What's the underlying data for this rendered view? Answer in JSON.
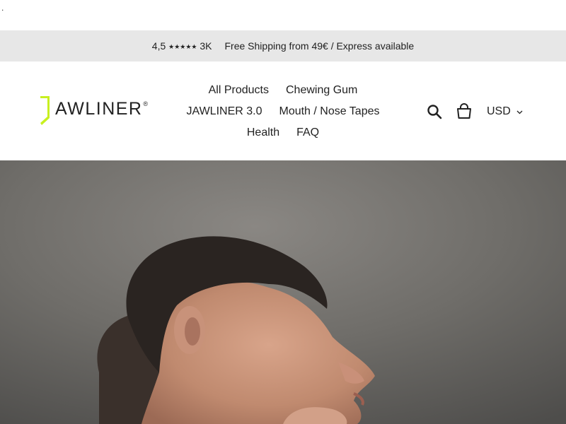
{
  "top_marker": ".",
  "announcement": {
    "rating": "4,5",
    "stars": "★★★★★",
    "reviews": "3K",
    "shipping": "Free Shipping from 49€ / Express available"
  },
  "logo": {
    "text": "AWLINER",
    "reg": "®",
    "accent_color": "#c8f020"
  },
  "nav": {
    "rows": [
      [
        "All Products",
        "Chewing Gum"
      ],
      [
        "JAWLINER 3.0",
        "Mouth / Nose Tapes"
      ],
      [
        "Health",
        "FAQ"
      ]
    ]
  },
  "header_icons": {
    "search": "search-icon",
    "cart": "cart-icon",
    "currency": "USD"
  },
  "hero": {
    "image": "man-profile-photo"
  }
}
